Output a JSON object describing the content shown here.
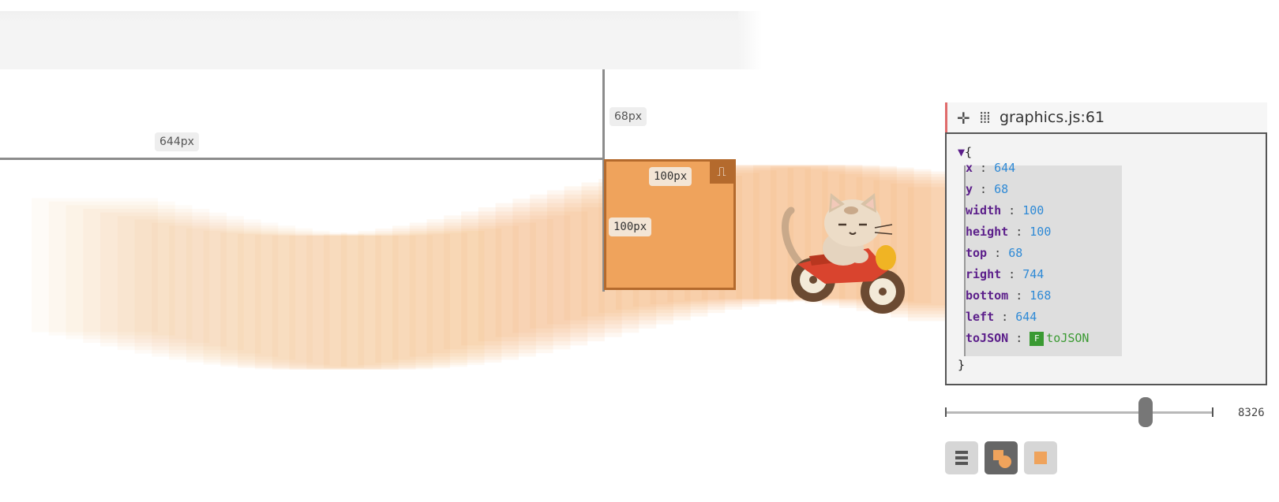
{
  "measurements": {
    "x_label": "644px",
    "y_label": "68px",
    "width_label": "100px",
    "height_label": "100px"
  },
  "inspector": {
    "title": "graphics.js:61",
    "move_icon": "move-icon",
    "drag_icon": "drag-grip-icon",
    "open_brace": "{",
    "close_brace": "}",
    "properties": [
      {
        "key": "x",
        "value": "644"
      },
      {
        "key": "y",
        "value": "68"
      },
      {
        "key": "width",
        "value": "100"
      },
      {
        "key": "height",
        "value": "100"
      },
      {
        "key": "top",
        "value": "68"
      },
      {
        "key": "right",
        "value": "744"
      },
      {
        "key": "bottom",
        "value": "168"
      },
      {
        "key": "left",
        "value": "644"
      }
    ],
    "method": {
      "key": "toJSON",
      "badge": "F",
      "value": "toJSON"
    }
  },
  "timeline": {
    "value": "8326",
    "position_fraction": 0.75
  },
  "modes": [
    {
      "icon": "list-icon",
      "active": false
    },
    {
      "icon": "shapes-icon",
      "active": true
    },
    {
      "icon": "square-icon",
      "active": false
    }
  ],
  "colors": {
    "box_fill": "#efa35c",
    "box_border": "#b46a2d",
    "trail": "#f1a85f",
    "accent": "#e06b6b",
    "value_blue": "#2f8ad6",
    "key_purple": "#5b1e8a",
    "function_green": "#3a9a32"
  }
}
